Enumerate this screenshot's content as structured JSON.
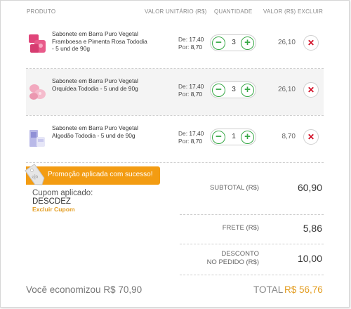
{
  "header": {
    "produto": "PRODUTO",
    "valor_unitario": "VALOR UNITÁRIO (R$)",
    "quantidade": "QUANTIDADE",
    "valor": "VALOR (R$)",
    "excluir": "EXCLUIR"
  },
  "items": [
    {
      "name": "Sabonete em Barra Puro Vegetal Framboesa e Pimenta Rosa Tododia - 5 und de 90g",
      "de_label": "De:",
      "de_value": "17,40",
      "por_label": "Por:",
      "por_value": "8,70",
      "quantity": "3",
      "total": "26,10",
      "minus": "−",
      "plus": "+",
      "delete": "✕",
      "image_color": "#e0457a"
    },
    {
      "name": "Sabonete em Barra Puro Vegetal Orquídea Tododia - 5 und de 90g",
      "de_label": "De:",
      "de_value": "17,40",
      "por_label": "Por:",
      "por_value": "8,70",
      "quantity": "3",
      "total": "26,10",
      "minus": "−",
      "plus": "+",
      "delete": "✕",
      "image_color": "#f2a9bf"
    },
    {
      "name": "Sabonete em Barra Puro Vegetal Algodão Tododia - 5 und de 90g",
      "de_label": "De:",
      "de_value": "17,40",
      "por_label": "Por:",
      "por_value": "8,70",
      "quantity": "1",
      "total": "8,70",
      "minus": "−",
      "plus": "+",
      "delete": "✕",
      "image_color": "#8f8fd6"
    }
  ],
  "promo": {
    "message": "Promoção aplicada com sucesso!",
    "tag_text": "%"
  },
  "coupon": {
    "label": "Cupom aplicado:",
    "code": "DESCDEZ",
    "remove": "Excluir Cupom"
  },
  "summary": {
    "subtotal_label": "SUBTOTAL (R$)",
    "subtotal_value": "60,90",
    "frete_label": "FRETE (R$)",
    "frete_value": "5,86",
    "desconto_label_1": "DESCONTO",
    "desconto_label_2": "NO PEDIDO (R$)",
    "desconto_value": "10,00"
  },
  "footer": {
    "economy": "Você economizou R$ 70,90",
    "total_label": "TOTAL",
    "total_value": "R$ 56,76"
  },
  "colors": {
    "accent_orange": "#f39c12",
    "plus_minus_green": "#37a846",
    "delete_red": "#d0021b"
  }
}
